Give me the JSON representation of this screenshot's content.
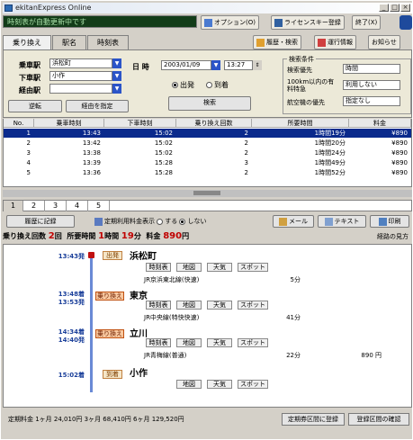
{
  "window": {
    "title": "ekitanExpress Online",
    "minimize": "_",
    "maximize": "□",
    "close": "×"
  },
  "status_text": "時刻表が自動更新中です",
  "toolbar": {
    "options": "オプション(O)",
    "license": "ライセンスキー登録",
    "exit": "終了(X)",
    "history": "履歴・検索",
    "traffic": "運行情報",
    "notice": "お知らせ"
  },
  "tabs": [
    "乗り換え",
    "駅名",
    "時刻表"
  ],
  "search": {
    "from_label": "乗車駅",
    "from_value": "浜松町",
    "to_label": "下車駅",
    "to_value": "小作",
    "via_label": "経由駅",
    "via_value": "",
    "datetime_label": "日 時",
    "date_value": "2003/01/09",
    "time_value": "13:27",
    "depart_label": "出発",
    "arrive_label": "到着",
    "swap_button": "逆転",
    "via_button": "経由を指定",
    "search_button": "検索"
  },
  "conditions": {
    "legend": "検索条件",
    "type_label": "検索優先",
    "type_value": "時間",
    "express_label": "100km以内の有料特急",
    "express_value": "利用しない",
    "plane_label": "航空機の優先",
    "plane_value": "指定なし"
  },
  "table": {
    "headers": [
      "No.",
      "乗車時刻",
      "下車時刻",
      "乗り換え回数",
      "所要時間",
      "料金"
    ],
    "rows": [
      [
        "1",
        "13:43",
        "15:02",
        "2",
        "1時間19分",
        "¥890"
      ],
      [
        "2",
        "13:42",
        "15:02",
        "2",
        "1時間20分",
        "¥890"
      ],
      [
        "3",
        "13:38",
        "15:02",
        "2",
        "1時間24分",
        "¥890"
      ],
      [
        "4",
        "13:39",
        "15:28",
        "3",
        "1時間49分",
        "¥890"
      ],
      [
        "5",
        "13:36",
        "15:28",
        "2",
        "1時間52分",
        "¥890"
      ]
    ]
  },
  "page_tabs": [
    "1",
    "2",
    "3",
    "4",
    "5"
  ],
  "actions": {
    "history_add": "履歴に記録",
    "commuter": "定期利用料金表示",
    "show": "する",
    "hide": "しない",
    "mail": "メール",
    "text": "テキスト",
    "print": "印刷"
  },
  "summary": {
    "transfers_label": "乗り換え回数",
    "transfers_value": "2",
    "transfers_unit": "回",
    "time_label": "所要時間",
    "time_hours": "1",
    "time_hours_unit": "時間",
    "time_minutes": "19",
    "time_minutes_unit": "分",
    "fare_label": "料金",
    "fare_value": "890",
    "fare_unit": "円",
    "legend_link": "経路の見方"
  },
  "route": [
    {
      "time": "13:43発",
      "badge": "出発",
      "station": "浜松町",
      "line": "JR京浜東北線(快速)",
      "duration": "5分",
      "fare": ""
    },
    {
      "time_arr": "13:48着",
      "time": "13:53発",
      "badge": "乗り換え",
      "station": "東京",
      "line": "JR中央線(特快快速)",
      "duration": "41分",
      "fare": ""
    },
    {
      "time_arr": "14:34着",
      "time": "14:40発",
      "badge": "乗り換え",
      "station": "立川",
      "line": "JR青梅線(普通)",
      "duration": "22分",
      "fare": "890 円"
    },
    {
      "time": "15:02着",
      "badge": "到着",
      "station": "小作",
      "line": "",
      "duration": "",
      "fare": ""
    }
  ],
  "station_buttons": {
    "timetable": "時刻表",
    "map": "地図",
    "weather": "天気",
    "spot": "スポット"
  },
  "footer": {
    "text": "定期料金  1ヶ月 24,010円  3ヶ月 68,410円  6ヶ月 129,520円",
    "btn1": "定期券区間に登録",
    "btn2": "登録区間の確認"
  }
}
